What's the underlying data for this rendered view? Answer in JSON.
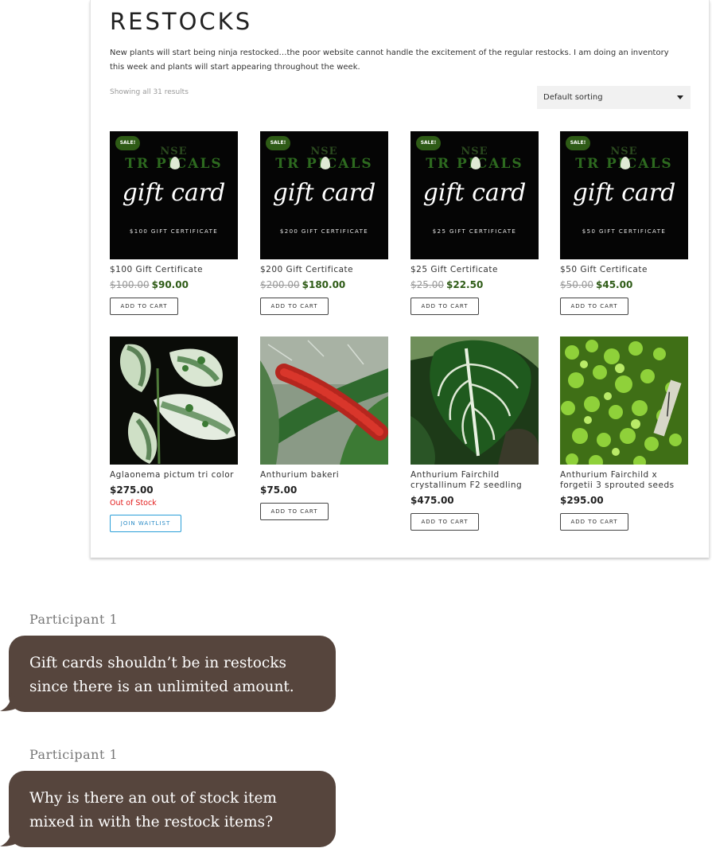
{
  "page": {
    "title": "RESTOCKS",
    "intro": "New plants will start being ninja restocked…the poor website cannot handle the excitement of the regular restocks. I am doing an inventory this week and plants will start appearing throughout the week.",
    "result_count": "Showing all 31 results",
    "sort_selected": "Default sorting"
  },
  "gift_card_art": {
    "brand_top": "NSE",
    "brand": "TR  PICALS",
    "script": "gift card",
    "sale_badge": "SALE!"
  },
  "products": [
    {
      "name": "$100 Gift Certificate",
      "certificate_text": "$100 GIFT CERTIFICATE",
      "old_price": "$100.00",
      "price": "$90.00",
      "button": "ADD TO CART"
    },
    {
      "name": "$200 Gift Certificate",
      "certificate_text": "$200 GIFT CERTIFICATE",
      "old_price": "$200.00",
      "price": "$180.00",
      "button": "ADD TO CART"
    },
    {
      "name": "$25 Gift Certificate",
      "certificate_text": "$25 GIFT CERTIFICATE",
      "old_price": "$25.00",
      "price": "$22.50",
      "button": "ADD TO CART"
    },
    {
      "name": "$50 Gift Certificate",
      "certificate_text": "$50 GIFT CERTIFICATE",
      "old_price": "$50.00",
      "price": "$45.00",
      "button": "ADD TO CART"
    },
    {
      "name": "Aglaonema pictum tri color",
      "price": "$275.00",
      "stock_status": "Out of Stock",
      "button": "JOIN WAITLIST"
    },
    {
      "name": "Anthurium bakeri",
      "price": "$75.00",
      "button": "ADD TO CART"
    },
    {
      "name": "Anthurium Fairchild crystallinum F2 seedling",
      "price": "$475.00",
      "button": "ADD TO CART"
    },
    {
      "name": "Anthurium Fairchild x forgetii 3 sprouted seeds",
      "price": "$295.00",
      "button": "ADD TO CART"
    }
  ],
  "comments": [
    {
      "author": "Participant 1",
      "line1": "Gift cards shouldn’t be in restocks",
      "line2": "since there is an unlimited amount."
    },
    {
      "author": "Participant 1",
      "line1": "Why is there an out of stock item",
      "line2": "mixed in with the restock items?"
    }
  ],
  "colors": {
    "sale_green": "#2e5b16",
    "out_of_stock_red": "#e21b1b",
    "waitlist_blue": "#2a9fd8",
    "bubble_brown": "#56453d"
  },
  "icons": [
    "dropdown-caret-icon",
    "speech-bubble-tail-icon"
  ]
}
